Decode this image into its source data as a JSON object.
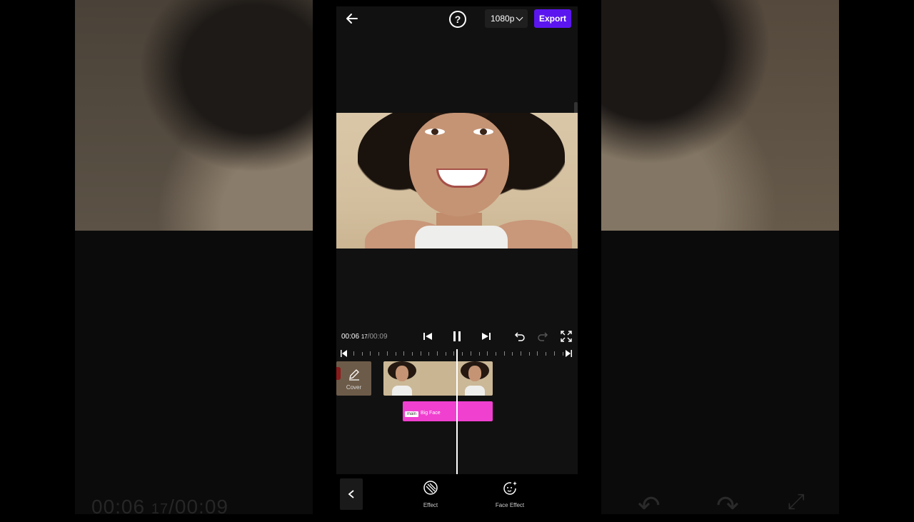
{
  "topbar": {
    "resolution": "1080p",
    "export_label": "Export",
    "help_label": "?"
  },
  "player": {
    "current_time": "00:06",
    "current_frames": "17",
    "total_time": "/00:09"
  },
  "timeline": {
    "cover_label": "Cover",
    "effect_tag": "main",
    "effect_name": "Big Face"
  },
  "toolbar": {
    "items": [
      {
        "label": "Effect",
        "icon": "effect-icon"
      },
      {
        "label": "Face Effect",
        "icon": "face-effect-icon"
      }
    ]
  },
  "background_ghost": {
    "time": "00:06",
    "frames": "17",
    "total": "/00:09"
  },
  "colors": {
    "export": "#5b16f0",
    "effect_bar": "#f040d0",
    "panel": "#111111"
  }
}
